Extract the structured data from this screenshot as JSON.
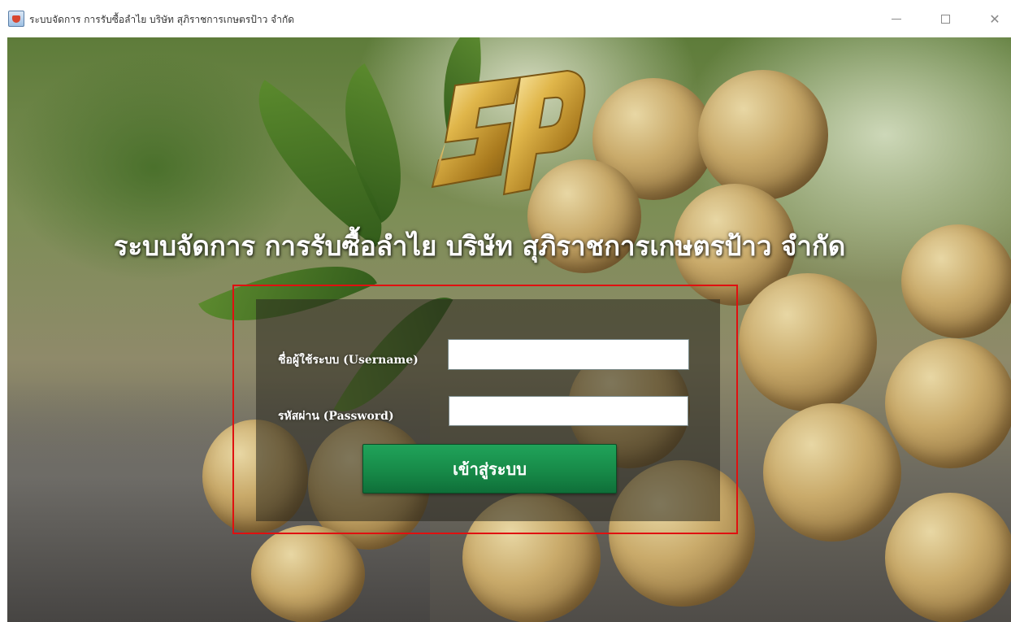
{
  "window": {
    "title": "ระบบจัดการ การรับซื้อลำไย บริษัท สุภิราชการเกษตรป้าว จำกัด",
    "minimize_glyph": "—",
    "maximize_glyph": "☐",
    "close_glyph": "✕"
  },
  "app": {
    "logo_icon": "sp-gold-logo",
    "title": "ระบบจัดการ การรับซื้อลำไย บริษัท สุภิราชการเกษตรป้าว จำกัด"
  },
  "login": {
    "username_label": "ชื่อผู้ใช้ระบบ (Username)",
    "username_value": "",
    "password_label": "รหัสผ่าน (Password)",
    "password_value": "",
    "submit_label": "เข้าสู่ระบบ"
  },
  "colors": {
    "highlight_border": "#e01010",
    "button_green": "#178a48",
    "logo_gold": "#c9a13a"
  }
}
